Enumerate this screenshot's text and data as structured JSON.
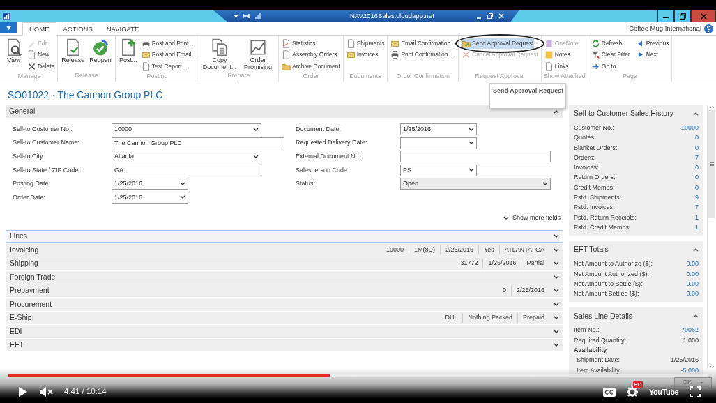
{
  "window": {
    "title": "NAV2016Sales.cloudapp.net"
  },
  "ribbon_tabs": [
    {
      "label": "HOME",
      "selected": true
    },
    {
      "label": "ACTIONS",
      "selected": false
    },
    {
      "label": "NAVIGATE",
      "selected": false
    }
  ],
  "company": "Coffee Mug International",
  "ribbon_groups": [
    {
      "label": "Manage",
      "large": [
        {
          "label": "View",
          "disabled": false,
          "highlighted": false
        }
      ],
      "small": [
        {
          "label": "Edit",
          "disabled": true,
          "highlighted": false
        },
        {
          "label": "New",
          "disabled": false,
          "highlighted": false
        },
        {
          "label": "Delete",
          "disabled": false,
          "highlighted": false
        }
      ]
    },
    {
      "label": "Release",
      "large": [
        {
          "label": "Release",
          "disabled": false,
          "highlighted": false
        },
        {
          "label": "Reopen",
          "disabled": false,
          "highlighted": false
        }
      ]
    },
    {
      "label": "Posting",
      "large": [
        {
          "label": "Post...",
          "disabled": false,
          "highlighted": false
        }
      ],
      "small": [
        {
          "label": "Post and Print...",
          "disabled": false,
          "highlighted": false
        },
        {
          "label": "Post and Email...",
          "disabled": false,
          "highlighted": false
        },
        {
          "label": "Test Report...",
          "disabled": false,
          "highlighted": false
        }
      ]
    },
    {
      "label": "Prepare",
      "large": [
        {
          "label": "Copy Document...",
          "disabled": false,
          "highlighted": false
        },
        {
          "label": "Order Promising",
          "disabled": false,
          "highlighted": false
        }
      ]
    },
    {
      "label": "Order",
      "small": [
        {
          "label": "Statistics",
          "disabled": false,
          "highlighted": false
        },
        {
          "label": "Assembly Orders",
          "disabled": false,
          "highlighted": false
        },
        {
          "label": "Archive Document",
          "disabled": false,
          "highlighted": false
        }
      ]
    },
    {
      "label": "Documents",
      "small": [
        {
          "label": "Shipments",
          "disabled": false,
          "highlighted": false
        },
        {
          "label": "Invoices",
          "disabled": false,
          "highlighted": false
        }
      ]
    },
    {
      "label": "Order Confirmation",
      "small": [
        {
          "label": "Email Confirmation...",
          "disabled": false,
          "highlighted": false
        },
        {
          "label": "Print Confirmation...",
          "disabled": false,
          "highlighted": false
        }
      ]
    },
    {
      "label": "Request Approval",
      "small": [
        {
          "label": "Send Approval Request",
          "disabled": false,
          "highlighted": true
        },
        {
          "label": "Cancel Approval Request",
          "disabled": true,
          "highlighted": false
        }
      ]
    },
    {
      "label": "Show Attached",
      "small": [
        {
          "label": "OneNote",
          "disabled": true,
          "highlighted": false
        },
        {
          "label": "Notes",
          "disabled": false,
          "highlighted": false
        },
        {
          "label": "Links",
          "disabled": false,
          "highlighted": false
        }
      ]
    },
    {
      "label": "Page",
      "small": [
        {
          "label": "Refresh",
          "disabled": false,
          "highlighted": false
        },
        {
          "label": "Clear Filter",
          "disabled": false,
          "highlighted": false
        },
        {
          "label": "Go to",
          "disabled": false,
          "highlighted": false
        },
        {
          "label": "Previous",
          "disabled": false,
          "highlighted": false
        },
        {
          "label": "Next",
          "disabled": false,
          "highlighted": false
        }
      ]
    }
  ],
  "tooltip": "Send Approval Request",
  "page_title": "SO01022 · The Cannon Group PLC",
  "general": {
    "label": "General",
    "expanded": true,
    "fields_left": [
      {
        "label": "Sell-to Customer No.:",
        "kind": "dropdown",
        "value": "10000",
        "disabled": false
      },
      {
        "label": "Sell-to Customer Name:",
        "kind": "text",
        "value": "The Cannon Group PLC",
        "disabled": false
      },
      {
        "label": "Sell-to City:",
        "kind": "dropdown",
        "value": "Atlanta",
        "disabled": false
      },
      {
        "label": "Sell-to State / ZIP Code:",
        "kind": "text",
        "value": "GA",
        "disabled": false
      },
      {
        "label": "Posting Date:",
        "kind": "dropdown",
        "value": "1/25/2016",
        "disabled": false
      },
      {
        "label": "Order Date:",
        "kind": "dropdown",
        "value": "1/25/2016",
        "disabled": false
      }
    ],
    "fields_right": [
      {
        "label": "Document Date:",
        "kind": "dropdown",
        "value": "1/25/2016",
        "disabled": false
      },
      {
        "label": "Requested Delivery Date:",
        "kind": "dropdown",
        "disabled": false
      },
      {
        "label": "External Document No.:",
        "kind": "text",
        "disabled": false
      },
      {
        "label": "Salesperson Code:",
        "kind": "dropdown",
        "value": "PS",
        "disabled": false
      },
      {
        "label": "Status:",
        "kind": "dropdown",
        "value": "Open",
        "disabled": true
      }
    ],
    "more_link": "Show more fields"
  },
  "fasttabs": [
    {
      "label": "Lines",
      "expanded": false,
      "selected": true
    },
    {
      "label": "Invoicing",
      "expanded": false,
      "selected": false,
      "summary": [
        "10000",
        "1M(8D)",
        "2/25/2016",
        "Yes",
        "ATLANTA, GA"
      ]
    },
    {
      "label": "Shipping",
      "expanded": false,
      "selected": false,
      "summary": [
        "31772",
        "1/25/2016",
        "Partial"
      ]
    },
    {
      "label": "Foreign Trade",
      "expanded": false,
      "selected": false
    },
    {
      "label": "Prepayment",
      "expanded": false,
      "selected": false,
      "summary": [
        "0",
        "2/25/2016"
      ]
    },
    {
      "label": "Procurement",
      "expanded": false,
      "selected": false
    },
    {
      "label": "E-Ship",
      "expanded": false,
      "selected": false,
      "summary": [
        "DHL",
        "Nothing Packed",
        "Prepaid"
      ]
    },
    {
      "label": "EDI",
      "expanded": false,
      "selected": false
    },
    {
      "label": "EFT",
      "expanded": false,
      "selected": false
    }
  ],
  "factboxes": [
    {
      "title": "Sell-to Customer Sales History",
      "expanded": true,
      "rows": [
        {
          "kind": "row",
          "label": "Customer No.:",
          "value": "10000",
          "link": true
        },
        {
          "kind": "row",
          "label": "Quotes:",
          "value": "0",
          "link": true
        },
        {
          "kind": "row",
          "label": "Blanket Orders:",
          "value": "0",
          "link": true
        },
        {
          "kind": "row",
          "label": "Orders:",
          "value": "7",
          "link": true
        },
        {
          "kind": "row",
          "label": "Invoices:",
          "value": "0",
          "link": true
        },
        {
          "kind": "row",
          "label": "Return Orders:",
          "value": "0",
          "link": true
        },
        {
          "kind": "row",
          "label": "Credit Memos:",
          "value": "0",
          "link": true
        },
        {
          "kind": "row",
          "label": "Pstd. Shipments:",
          "value": "9",
          "link": true
        },
        {
          "kind": "row",
          "label": "Pstd. Invoices:",
          "value": "7",
          "link": true
        },
        {
          "kind": "row",
          "label": "Pstd. Return Receipts:",
          "value": "1",
          "link": true
        },
        {
          "kind": "row",
          "label": "Pstd. Credit Memos:",
          "value": "1",
          "link": true
        }
      ]
    },
    {
      "title": "EFT Totals",
      "expanded": true,
      "rows": [
        {
          "kind": "row",
          "label": "Net Amount to Authorize ($):",
          "value": "0.00",
          "link": true
        },
        {
          "kind": "row",
          "label": "Net Amount Authorized ($):",
          "value": "0.00",
          "link": true
        },
        {
          "kind": "row",
          "label": "Net Amount to Settle ($):",
          "value": "0.00",
          "link": true
        },
        {
          "kind": "row",
          "label": "Net Amount Settled ($):",
          "value": "0.00",
          "link": true
        }
      ]
    },
    {
      "title": "Sales Line Details",
      "expanded": true,
      "rows": [
        {
          "kind": "row",
          "label": "Item No.:",
          "value": "70062",
          "link": true
        },
        {
          "kind": "row",
          "label": "Required Quantity:",
          "value": "1,000",
          "link": false
        },
        {
          "kind": "heading",
          "label": "Availability"
        },
        {
          "kind": "sub",
          "label": "Shipment Date:",
          "value": "1/25/2016",
          "link": false
        },
        {
          "kind": "sub",
          "label": "Item Availability",
          "value": "-5,000",
          "link": true
        }
      ]
    }
  ],
  "dialog_button": "OK",
  "player": {
    "level": 0.46,
    "playing": false,
    "muted": true,
    "time": "4:41 / 10:14",
    "hd_badge": "HD",
    "logo": "YouTube"
  }
}
